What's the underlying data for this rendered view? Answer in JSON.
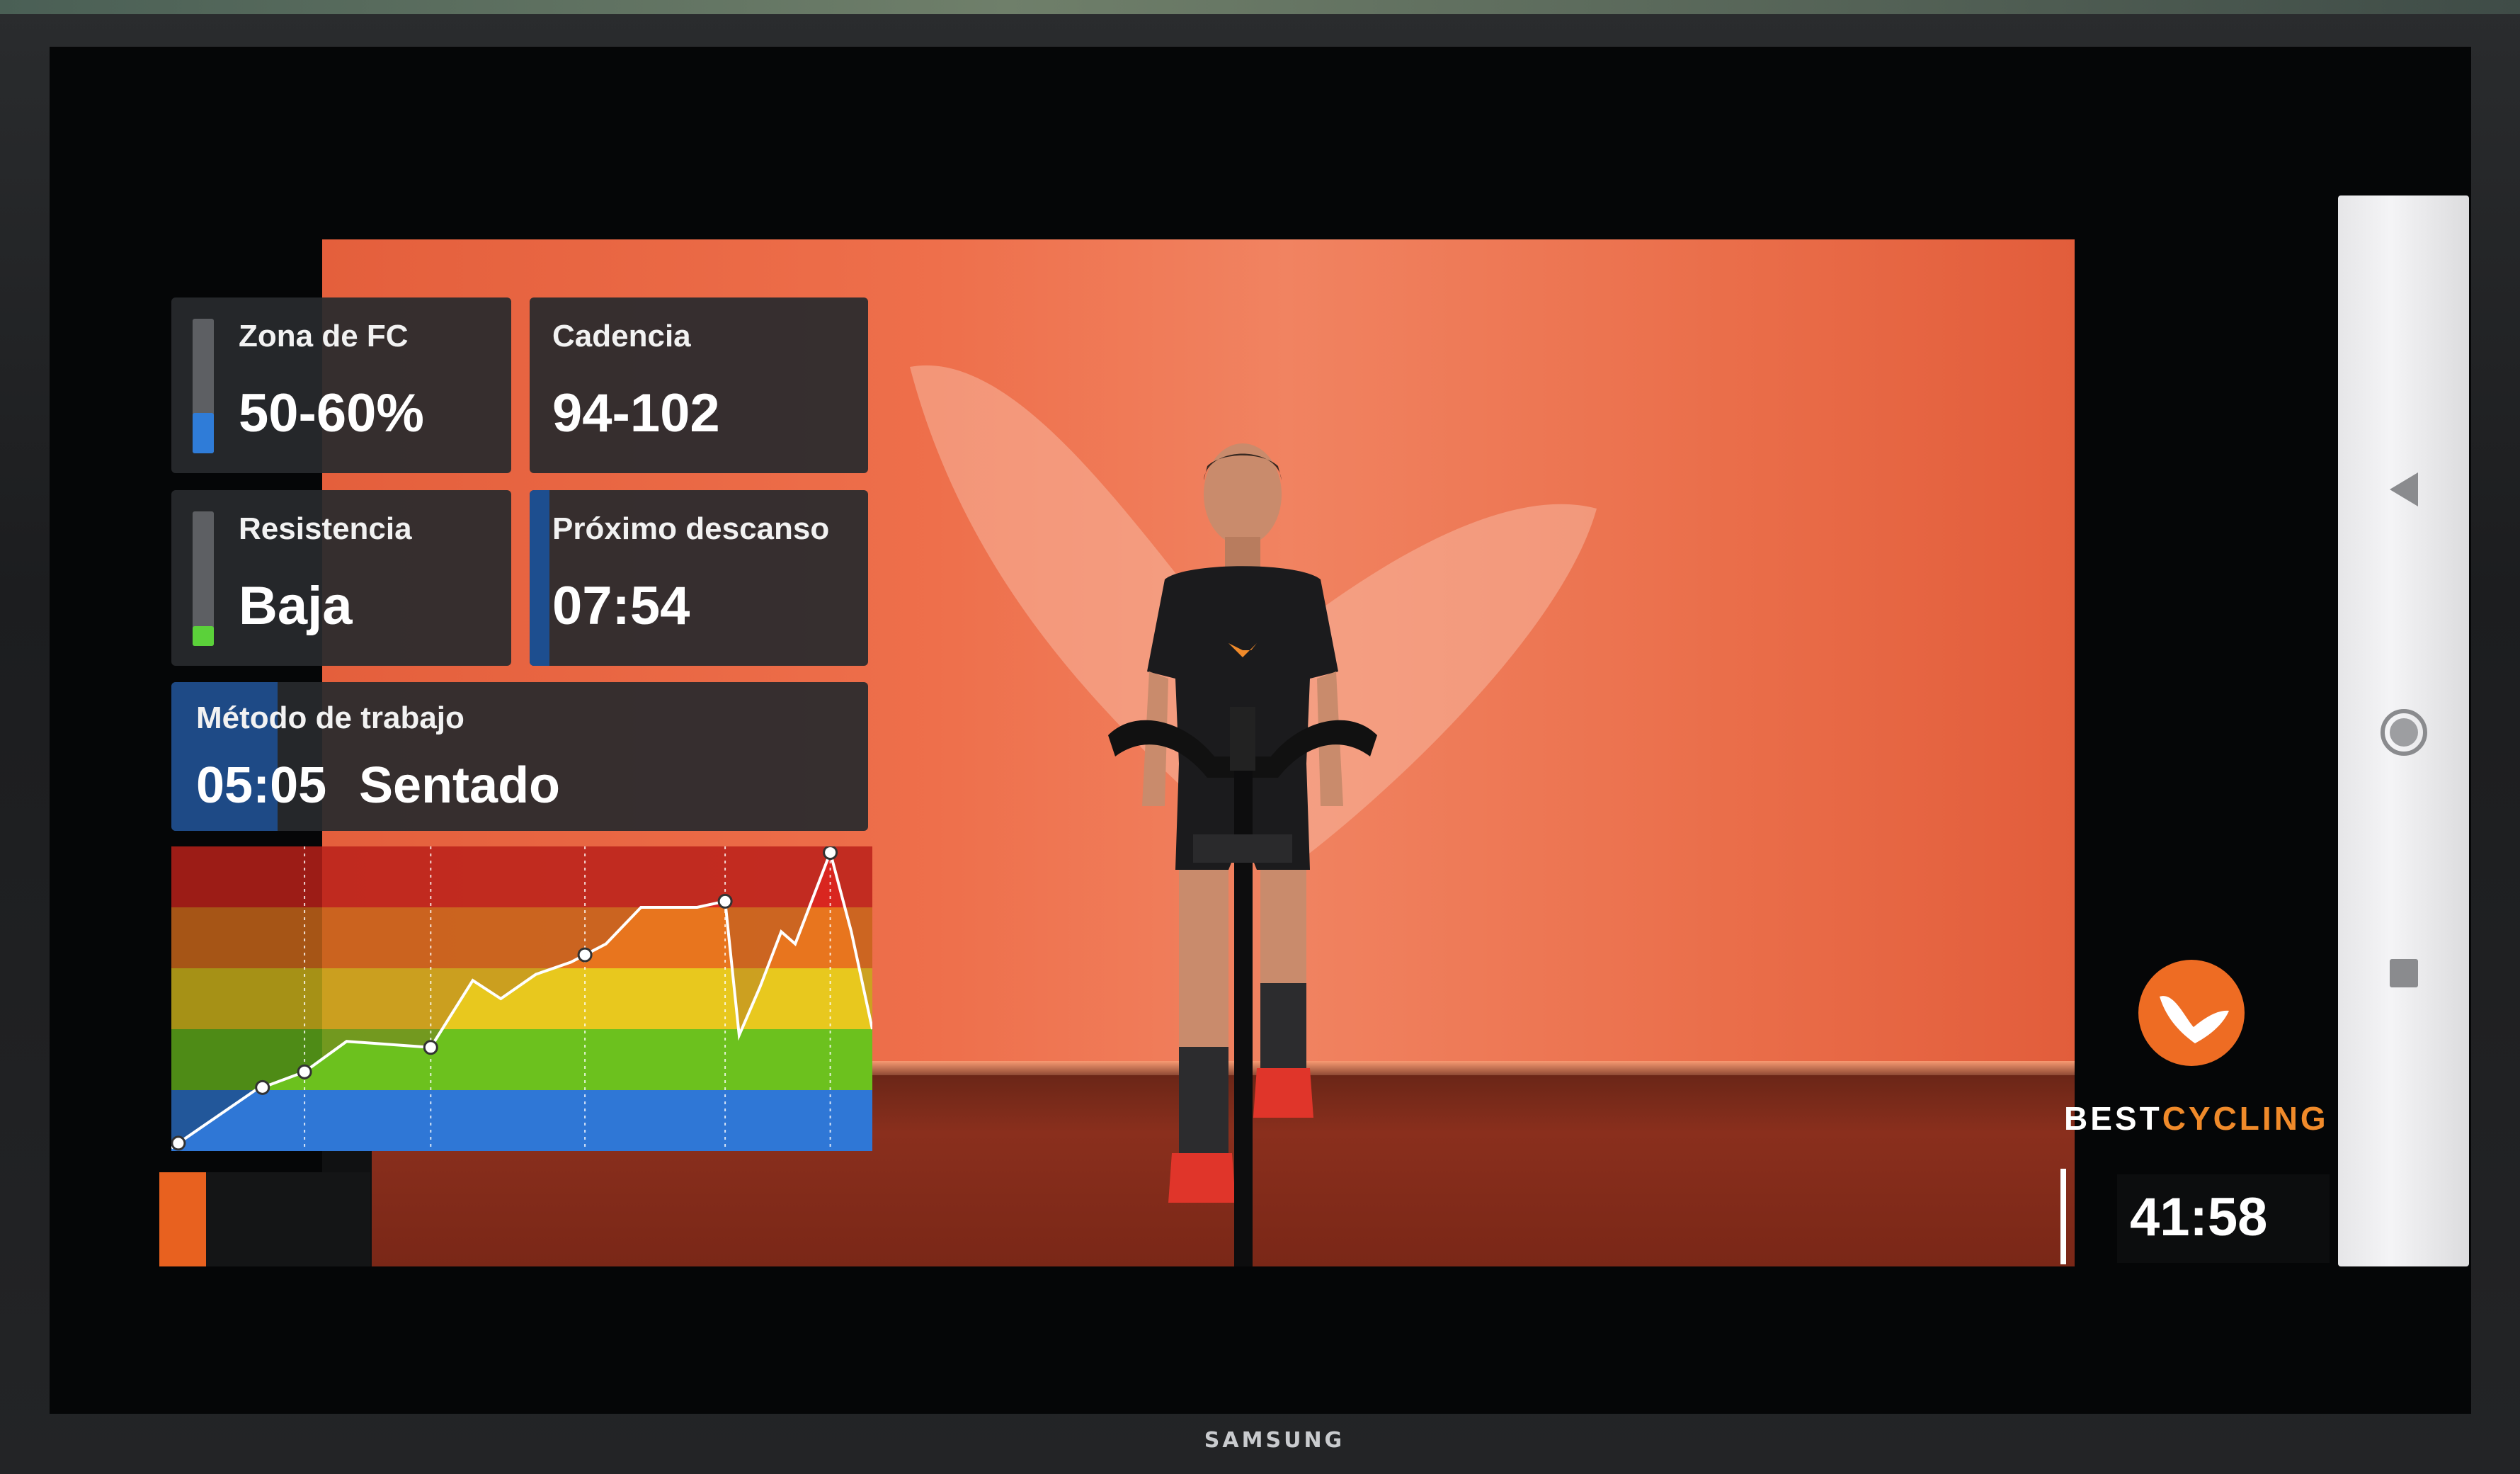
{
  "tv": {
    "brand": "SAMSUNG"
  },
  "stats": {
    "hr_zone": {
      "label": "Zona de FC",
      "value": "50-60%",
      "color": "#2f7cd8",
      "level": 0.3
    },
    "cadence": {
      "label": "Cadencia",
      "value": "94-102"
    },
    "resistance": {
      "label": "Resistencia",
      "value": "Baja",
      "color": "#5bd13a",
      "level": 0.15
    },
    "next_rest": {
      "label": "Próximo descanso",
      "value": "07:54"
    },
    "method": {
      "label": "Método de trabajo",
      "time": "05:05",
      "position": "Sentado"
    }
  },
  "chart_data": {
    "type": "line",
    "description_bands": [
      "#2f77d6",
      "#6cc11e",
      "#e8c81e",
      "#e8751e",
      "#d9261f"
    ],
    "zones": [
      1,
      2,
      3,
      4,
      5
    ],
    "ylim": [
      0,
      5
    ],
    "x": [
      0,
      0.12,
      0.19,
      0.25,
      0.37,
      0.43,
      0.47,
      0.52,
      0.57,
      0.62,
      0.67,
      0.71,
      0.75,
      0.79,
      0.81,
      0.84,
      0.87,
      0.89,
      0.94,
      0.97,
      1.0
    ],
    "values": [
      0.05,
      1.0,
      1.3,
      1.8,
      1.7,
      2.8,
      2.5,
      2.9,
      3.1,
      3.4,
      4.0,
      4.0,
      4.0,
      4.1,
      1.9,
      2.7,
      3.6,
      3.4,
      4.9,
      3.6,
      2.0
    ],
    "markers_x": [
      0.01,
      0.13,
      0.19,
      0.37,
      0.59,
      0.79,
      0.94
    ],
    "gridlines_x": [
      0.19,
      0.37,
      0.59,
      0.79,
      0.94
    ]
  },
  "player": {
    "brand_part1": "BEST",
    "brand_part2": "CYCLING",
    "time_remaining": "41:58"
  },
  "navbar": {
    "back_icon": "back-triangle-icon",
    "home_icon": "home-circle-icon",
    "recents_icon": "recents-square-icon"
  }
}
